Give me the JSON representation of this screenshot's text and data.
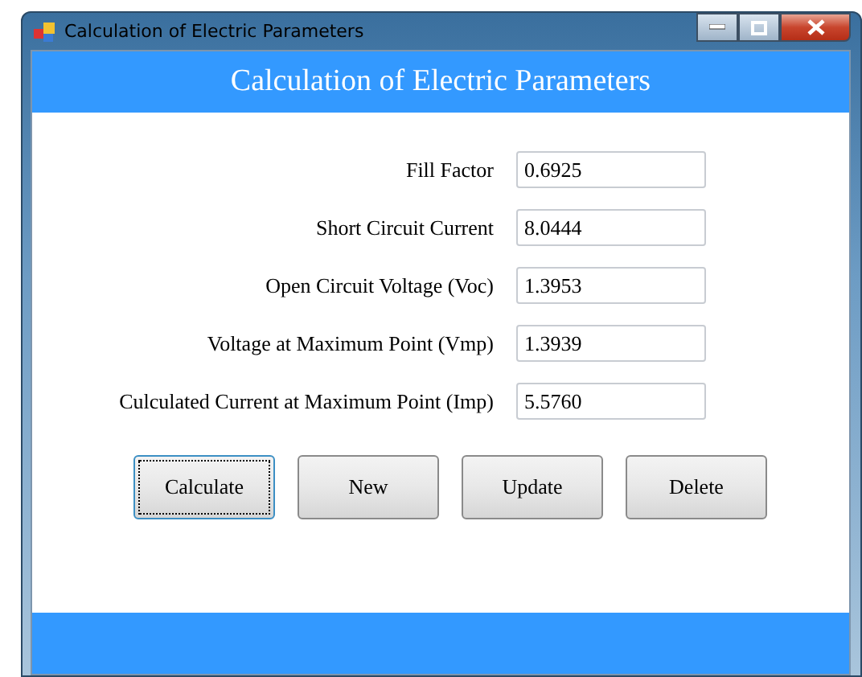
{
  "window": {
    "title": "Calculation of Electric Parameters"
  },
  "header": {
    "title": "Calculation of Electric Parameters"
  },
  "fields": [
    {
      "label": "Fill Factor",
      "value": "0.6925"
    },
    {
      "label": "Short Circuit Current",
      "value": "8.0444"
    },
    {
      "label": "Open Circuit Voltage (Voc)",
      "value": "1.3953"
    },
    {
      "label": "Voltage at Maximum Point (Vmp)",
      "value": "1.3939"
    },
    {
      "label": "Culculated Current at Maximum Point (Imp)",
      "value": "5.5760"
    }
  ],
  "buttons": [
    {
      "label": "Calculate",
      "focused": true
    },
    {
      "label": "New",
      "focused": false
    },
    {
      "label": "Update",
      "focused": false
    },
    {
      "label": "Delete",
      "focused": false
    }
  ]
}
